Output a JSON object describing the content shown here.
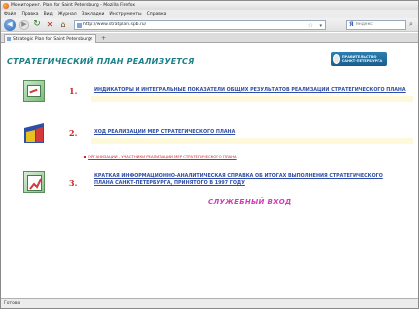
{
  "window": {
    "title": "Мониторинг. Plan for Saint Petersburg - Mozilla Firefox"
  },
  "menu": [
    "Файл",
    "Правка",
    "Вид",
    "Журнал",
    "Закладки",
    "Инструменты",
    "Справка"
  ],
  "nav": {
    "url": "http://www.stratplan.spb.ru/",
    "search_placeholder": "Яндекс"
  },
  "tab": {
    "label": "Strategic Plan for Saint Petersburg"
  },
  "page": {
    "title": "СТРАТЕГИЧЕСКИЙ ПЛАН РЕАЛИЗУЕТСЯ",
    "logo_text": "ПРАВИТЕЛЬСТВО САНКТ-ПЕТЕРБУРГА",
    "items": [
      {
        "number": "1.",
        "link": "ИНДИКАТОРЫ И ИНТЕГРАЛЬНЫЕ ПОКАЗАТЕЛИ ОБЩИХ РЕЗУЛЬТАТОВ РЕАЛИЗАЦИИ СТРАТЕГИЧЕСКОГО ПЛАНА"
      },
      {
        "number": "2.",
        "link": "ХОД РЕАЛИЗАЦИИ МЕР СТРАТЕГИЧЕСКОГО ПЛАНА"
      },
      {
        "number": "3.",
        "link_line1": "КРАТКАЯ ИНФОРМАЦИОННО-АНАЛИТИЧЕСКАЯ СПРАВКА ОБ ИТОГАХ ВЫПОЛНЕНИЯ СТРАТЕГИЧЕСКОГО",
        "link_line2": "ПЛАНА САНКТ-ПЕТЕРБУРГА, ПРИНЯТОГО В 1997 ГОДУ"
      }
    ],
    "sublink": "ОРГАНИЗАЦИИ - УЧАСТНИКИ РЕАЛИЗАЦИИ МЕР СТРАТЕГИЧЕСКОГО ПЛАНА",
    "service_login": "СЛУЖЕБНЫЙ ВХОД"
  },
  "status": {
    "text": "Готово"
  }
}
